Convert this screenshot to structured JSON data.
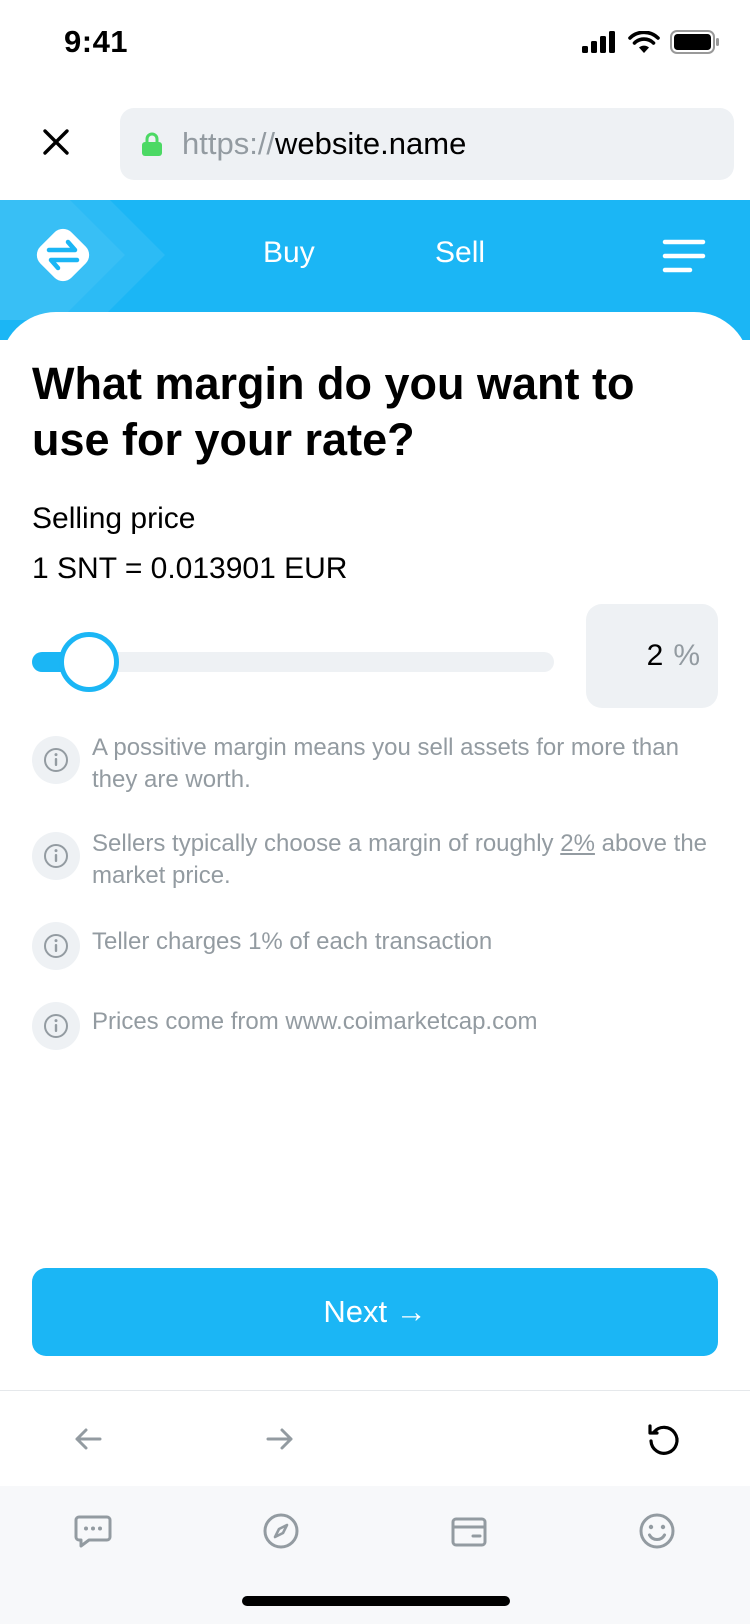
{
  "status_bar": {
    "time": "9:41"
  },
  "address_bar": {
    "url_scheme": "https://",
    "url_host": "website.name"
  },
  "header": {
    "nav_buy": "Buy",
    "nav_sell": "Sell"
  },
  "page": {
    "title": "What margin do you want to use for your rate?",
    "price_label": "Selling price",
    "price_value": "1 SNT = 0.013901 EUR"
  },
  "margin": {
    "value": "2",
    "unit": "%",
    "slider_fraction": 0.11
  },
  "info_items": [
    {
      "text": "A possitive margin means you sell assets for more than they are worth."
    },
    {
      "text_before": "Sellers typically choose a margin of roughly ",
      "text_link": "2%",
      "text_after": " above the market price."
    },
    {
      "text": "Teller charges 1% of each transaction"
    },
    {
      "text": "Prices come from www.coimarketcap.com"
    }
  ],
  "next_button": {
    "label": "Next →"
  },
  "colors": {
    "accent": "#1bb6f5",
    "muted_text": "#939ba1",
    "field_bg": "#eef1f4"
  }
}
